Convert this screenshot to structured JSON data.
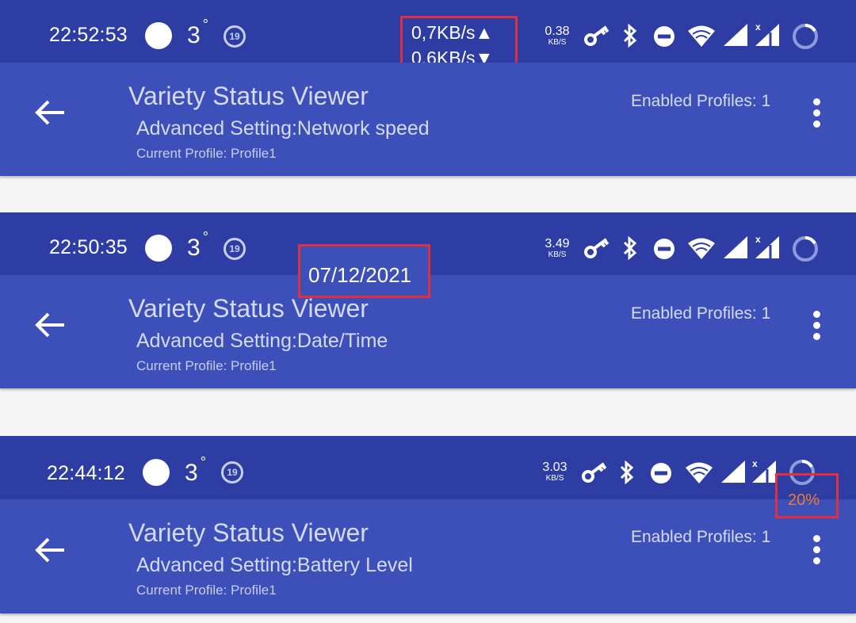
{
  "panels": [
    {
      "status": {
        "time": "22:52:53",
        "temp": "3",
        "degree": "°",
        "notif_badge": "19",
        "net_value": "0.38",
        "net_unit": "KB/S"
      },
      "speed_overlay": {
        "up": "0,7KB/s",
        "up_arrow": "▲",
        "down": "0,6KB/s",
        "down_arrow": "▼"
      },
      "app": {
        "title": "Variety Status Viewer",
        "subtitle": "Advanced Setting:Network speed",
        "profile": "Current Profile: Profile1",
        "enabled": "Enabled Profiles: 1"
      }
    },
    {
      "status": {
        "time": "22:50:35",
        "temp": "3",
        "degree": "°",
        "notif_badge": "19",
        "net_value": "3.49",
        "net_unit": "KB/S"
      },
      "date_overlay": "07/12/2021",
      "app": {
        "title": "Variety Status Viewer",
        "subtitle": "Advanced Setting:Date/Time",
        "profile": "Current Profile: Profile1",
        "enabled": "Enabled Profiles: 1"
      }
    },
    {
      "status": {
        "time": "22:44:12",
        "temp": "3",
        "degree": "°",
        "notif_badge": "19",
        "net_value": "3.03",
        "net_unit": "KB/S"
      },
      "battery_overlay": "20%",
      "app": {
        "title": "Variety Status Viewer",
        "subtitle": "Advanced Setting:Battery Level",
        "profile": "Current Profile: Profile1",
        "enabled": "Enabled Profiles: 1"
      }
    }
  ],
  "colors": {
    "statusbar": "#2e3da4",
    "appbar": "#3d4fb8",
    "highlight": "#e0303e",
    "battery_text": "#f07b2f"
  },
  "icons": [
    "key-icon",
    "bluetooth-icon",
    "do-not-disturb-icon",
    "wifi-icon",
    "signal-icon",
    "signal-no-data-icon",
    "battery-ring-icon",
    "back-arrow-icon",
    "more-vert-icon"
  ]
}
